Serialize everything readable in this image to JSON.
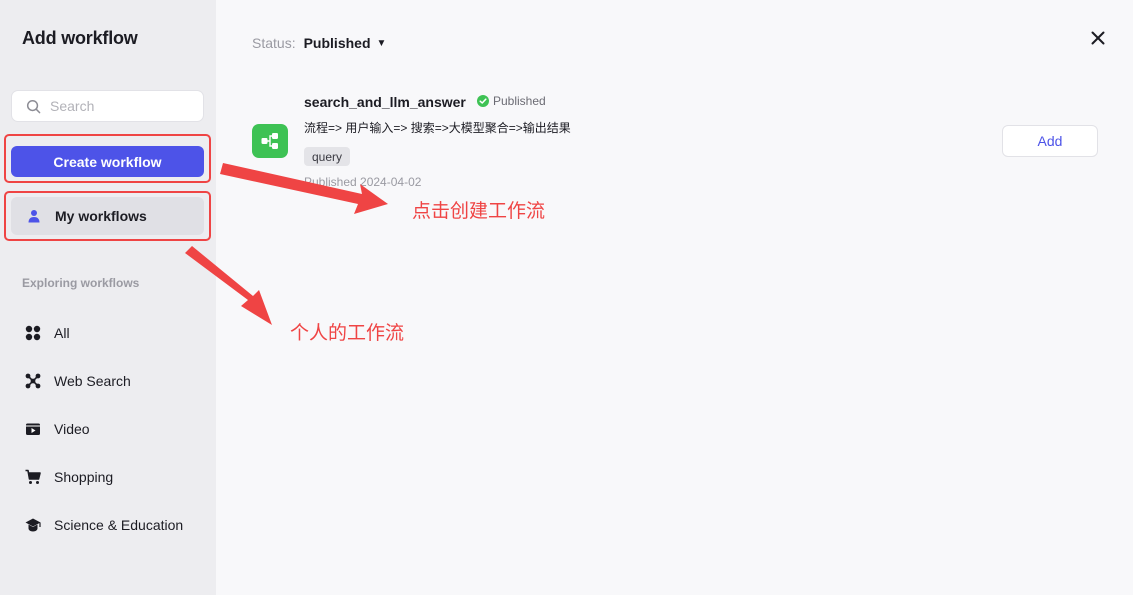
{
  "sidebar": {
    "title": "Add workflow",
    "search_placeholder": "Search",
    "create_label": "Create workflow",
    "my_workflows_label": "My workflows",
    "section_label": "Exploring workflows",
    "items": [
      {
        "label": "All",
        "icon": "grid-icon"
      },
      {
        "label": "Web Search",
        "icon": "web-search-icon"
      },
      {
        "label": "Video",
        "icon": "video-icon"
      },
      {
        "label": "Shopping",
        "icon": "cart-icon"
      },
      {
        "label": "Science & Education",
        "icon": "graduation-cap-icon"
      }
    ]
  },
  "main": {
    "status_label": "Status:",
    "status_value": "Published",
    "workflow": {
      "name": "search_and_llm_answer",
      "badge": "Published",
      "description": "流程=> 用户输入=> 搜索=>大模型聚合=>输出结果",
      "tag": "query",
      "date": "Published 2024-04-02",
      "add_label": "Add"
    }
  },
  "annotations": {
    "create": "点击创建工作流",
    "personal": "个人的工作流"
  },
  "colors": {
    "accent": "#4d53e8",
    "annotation": "#ef4444",
    "workflow_icon": "#3ec254",
    "published": "#3ec254"
  }
}
